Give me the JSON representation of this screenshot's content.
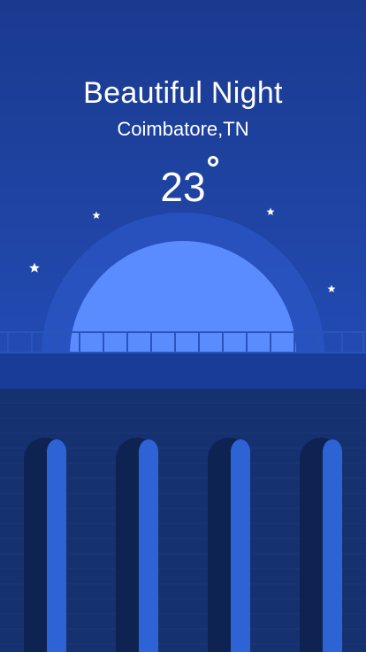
{
  "weather": {
    "headline": "Beautiful Night",
    "location": "Coimbatore,TN",
    "temperature": "23"
  },
  "icons": [
    "star-icon",
    "moon-icon",
    "degree-symbol-icon"
  ],
  "colors": {
    "sky_top": "#1a3a8f",
    "sky_bottom": "#234cb5",
    "moon": "#5a8cff",
    "moon_halo": "#2b56c4",
    "bridge_deck": "#1a3c99",
    "bridge_body": "#16316f",
    "arch_dark": "#0f2353",
    "arch_light": "#2e63d6",
    "text": "#ffffff"
  }
}
